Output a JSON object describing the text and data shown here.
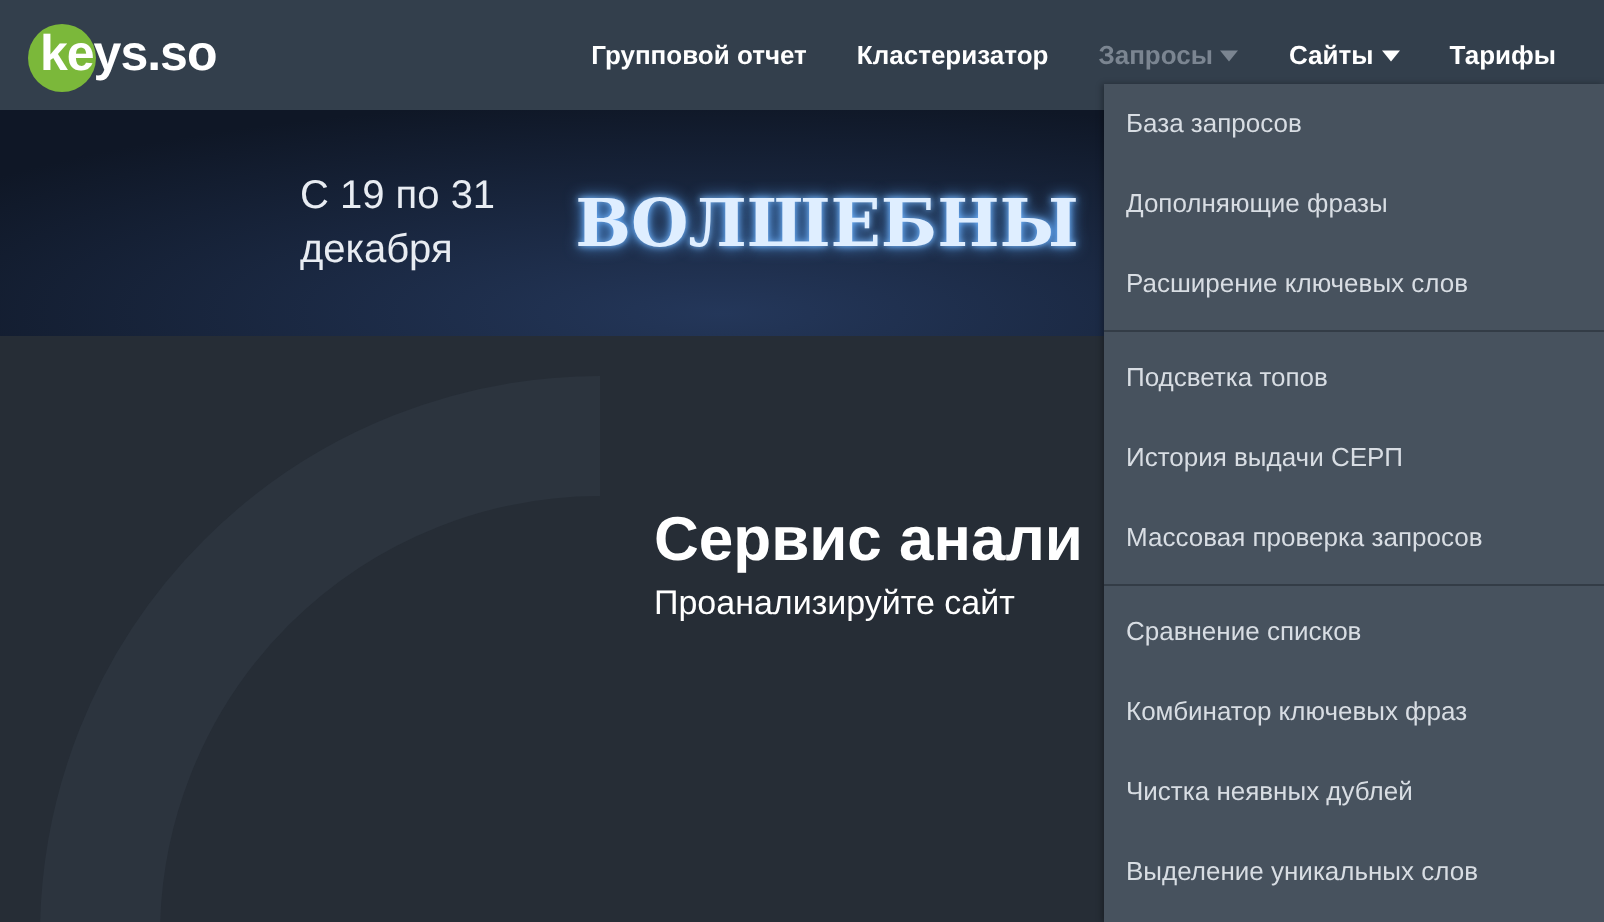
{
  "logo": {
    "text": "keys.so"
  },
  "nav": [
    {
      "label": "Групповой отчет",
      "has_dropdown": false,
      "selected": false
    },
    {
      "label": "Кластеризатор",
      "has_dropdown": false,
      "selected": false
    },
    {
      "label": "Запросы",
      "has_dropdown": true,
      "selected": true
    },
    {
      "label": "Сайты",
      "has_dropdown": true,
      "selected": false
    },
    {
      "label": "Тарифы",
      "has_dropdown": false,
      "selected": false
    }
  ],
  "banner": {
    "dates": "С 19 по 31",
    "month": "декабря",
    "headline": "ВОЛШЕБНЫ"
  },
  "hero": {
    "title": "Сервис анали",
    "subtitle": "Проанализируйте сайт"
  },
  "dropdown": {
    "groups": [
      [
        "База запросов",
        "Дополняющие фразы",
        "Расширение ключевых слов"
      ],
      [
        "Подсветка топов",
        "История выдачи СЕРП",
        "Массовая проверка запросов"
      ],
      [
        "Сравнение списков",
        "Комбинатор ключевых фраз",
        "Чистка неявных дублей",
        "Выделение уникальных слов"
      ]
    ]
  }
}
